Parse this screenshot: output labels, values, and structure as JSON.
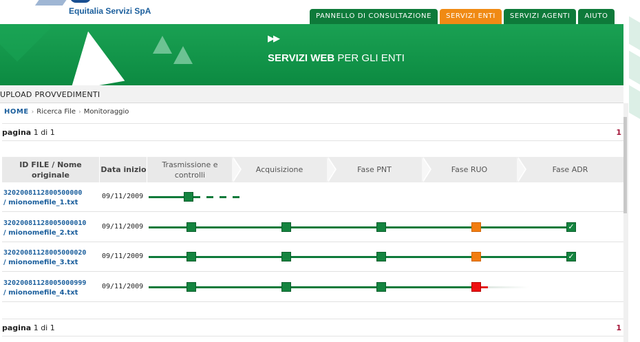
{
  "header": {
    "brand": "Equitalia Servizi SpA",
    "nav": [
      {
        "label": "PANNELLO DI CONSULTAZIONE",
        "active": false
      },
      {
        "label": "SERVIZI ENTI",
        "active": true
      },
      {
        "label": "SERVIZI AGENTI",
        "active": false
      },
      {
        "label": "AIUTO",
        "active": false
      }
    ]
  },
  "banner": {
    "title_bold": "SERVIZI WEB",
    "title_rest": " PER GLI ENTI",
    "icon": "double-play-icon"
  },
  "section": {
    "title": "UPLOAD PROVVEDIMENTI"
  },
  "breadcrumb": {
    "home": "HOME",
    "items": [
      "Ricerca File",
      "Monitoraggio"
    ],
    "separator_icon": "chevron-right-icon"
  },
  "pager": {
    "label": "pagina",
    "text": "1 di 1",
    "page": "1"
  },
  "table": {
    "columns": {
      "id": "ID FILE / Nome originale",
      "date": "Data inizio"
    },
    "phases": [
      "Trasmissione e controlli",
      "Acquisizione",
      "Fase PNT",
      "Fase RUO",
      "Fase ADR"
    ],
    "rows": [
      {
        "id": "3202008112800500000",
        "name": "/ mionomefile_1.txt",
        "date": "09/11/2009",
        "status": [
          "ok"
        ]
      },
      {
        "id": "32020081128005000010",
        "name": "/ mionomefile_2.txt",
        "date": "09/11/2009",
        "status": [
          "ok",
          "ok",
          "ok",
          "warning",
          "done"
        ]
      },
      {
        "id": "32020081128005000020",
        "name": "/ mionomefile_3.txt",
        "date": "09/11/2009",
        "status": [
          "ok",
          "ok",
          "ok",
          "warning",
          "done"
        ]
      },
      {
        "id": "32020081128005000999",
        "name": "/ mionomefile_4.txt",
        "date": "09/11/2009",
        "status": [
          "ok",
          "ok",
          "ok",
          "error"
        ]
      }
    ]
  },
  "colors": {
    "green": "#0e7a3a",
    "orange": "#f08a14",
    "red": "#ee1111",
    "link": "#1a5e9c"
  }
}
